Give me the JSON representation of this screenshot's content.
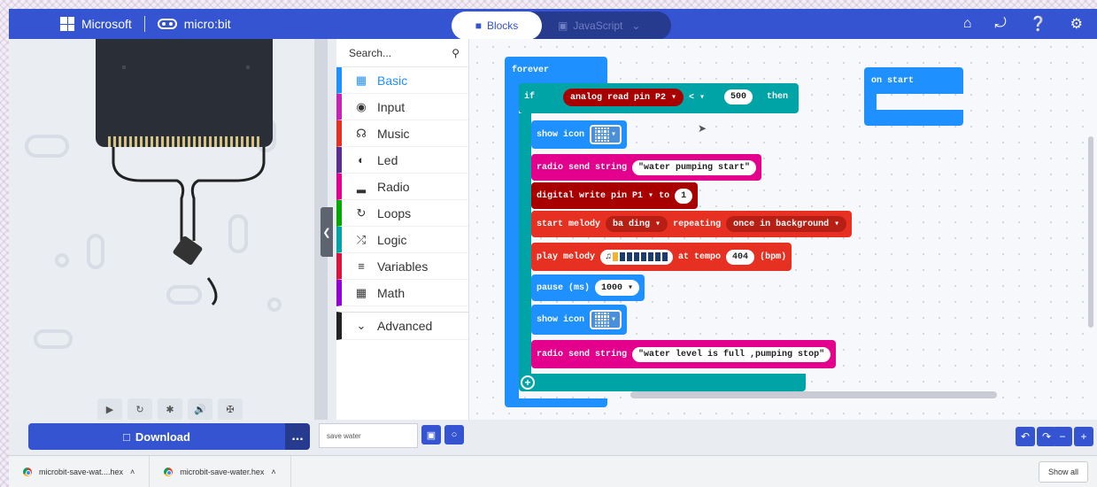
{
  "header": {
    "brand_ms": "Microsoft",
    "brand_mb": "micro:bit",
    "mode_blocks": "Blocks",
    "mode_js": "JavaScript",
    "icons": [
      "home-icon",
      "share-icon",
      "help-icon",
      "settings-icon"
    ]
  },
  "toolbox": {
    "search_placeholder": "Search...",
    "categories": [
      {
        "label": "Basic",
        "color": "#1e90ff"
      },
      {
        "label": "Input",
        "color": "#c724b1"
      },
      {
        "label": "Music",
        "color": "#e63022"
      },
      {
        "label": "Led",
        "color": "#5c2d91"
      },
      {
        "label": "Radio",
        "color": "#e3008c"
      },
      {
        "label": "Loops",
        "color": "#00aa00"
      },
      {
        "label": "Logic",
        "color": "#00a4a6"
      },
      {
        "label": "Variables",
        "color": "#dc143c"
      },
      {
        "label": "Math",
        "color": "#9400d3"
      }
    ],
    "advanced": "Advanced"
  },
  "blocks": {
    "forever": "forever",
    "on_start": "on start",
    "if_kw": "if",
    "then_kw": "then",
    "analog_read": "analog read pin P2",
    "compare_op": "<",
    "compare_value": "500",
    "show_icon": "show icon",
    "radio_send_1": "radio send string",
    "radio_text_1": "\"water pumping start\"",
    "digital_write": "digital write pin",
    "pin": "P1",
    "to_kw": "to",
    "digital_value": "1",
    "start_melody": "start melody",
    "melody_name": "ba ding",
    "repeating": "repeating",
    "repeat_mode": "once in background",
    "play_melody": "play melody",
    "at_tempo": "at tempo",
    "tempo": "404",
    "bpm": "(bpm)",
    "pause": "pause (ms)",
    "pause_value": "1000",
    "show_icon_2": "show icon",
    "radio_send_2": "radio send string",
    "radio_text_2": "\"water level is full ,pumping stop\""
  },
  "editor_bar": {
    "download": "Download",
    "more": "...",
    "project_name": "save water"
  },
  "downloads": {
    "items": [
      "microbit-save-wat....hex",
      "microbit-save-water.hex"
    ],
    "show_all": "Show all"
  },
  "colors": {
    "accent": "#3454d1",
    "basic": "#1e90ff",
    "logic": "#00a4a6",
    "radio": "#e3008c",
    "pins": "#a80000",
    "music": "#e63022"
  }
}
